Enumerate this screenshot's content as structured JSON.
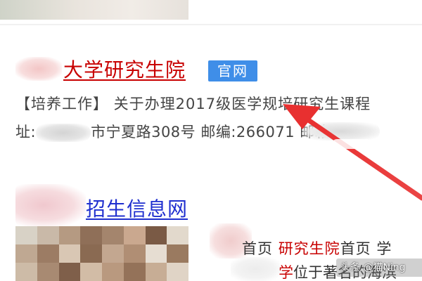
{
  "result1": {
    "title": "大学研究生院",
    "badge": "官网",
    "snippet": "【培养工作】 关于办理2017级医学规培研究生课程",
    "address_prefix": "址:",
    "address_city_suffix": "市宁夏路308号 邮编:266071 邮箱"
  },
  "result2": {
    "title": "招生信息网",
    "snippet_line1_a": "首页 ",
    "snippet_line1_red": "研究生院",
    "snippet_line1_b": "首页 学",
    "snippet_line2_red": "学",
    "snippet_line2_b": "位于著名的海滨"
  },
  "watermark": "头条 @猫Ning",
  "colors": {
    "title_red": "#c80000",
    "link_blue": "#1f2fcf",
    "badge_blue": "#3f8ee8",
    "arrow_red": "#e83030"
  },
  "icons": {
    "arrow": "red-annotation-arrow"
  }
}
